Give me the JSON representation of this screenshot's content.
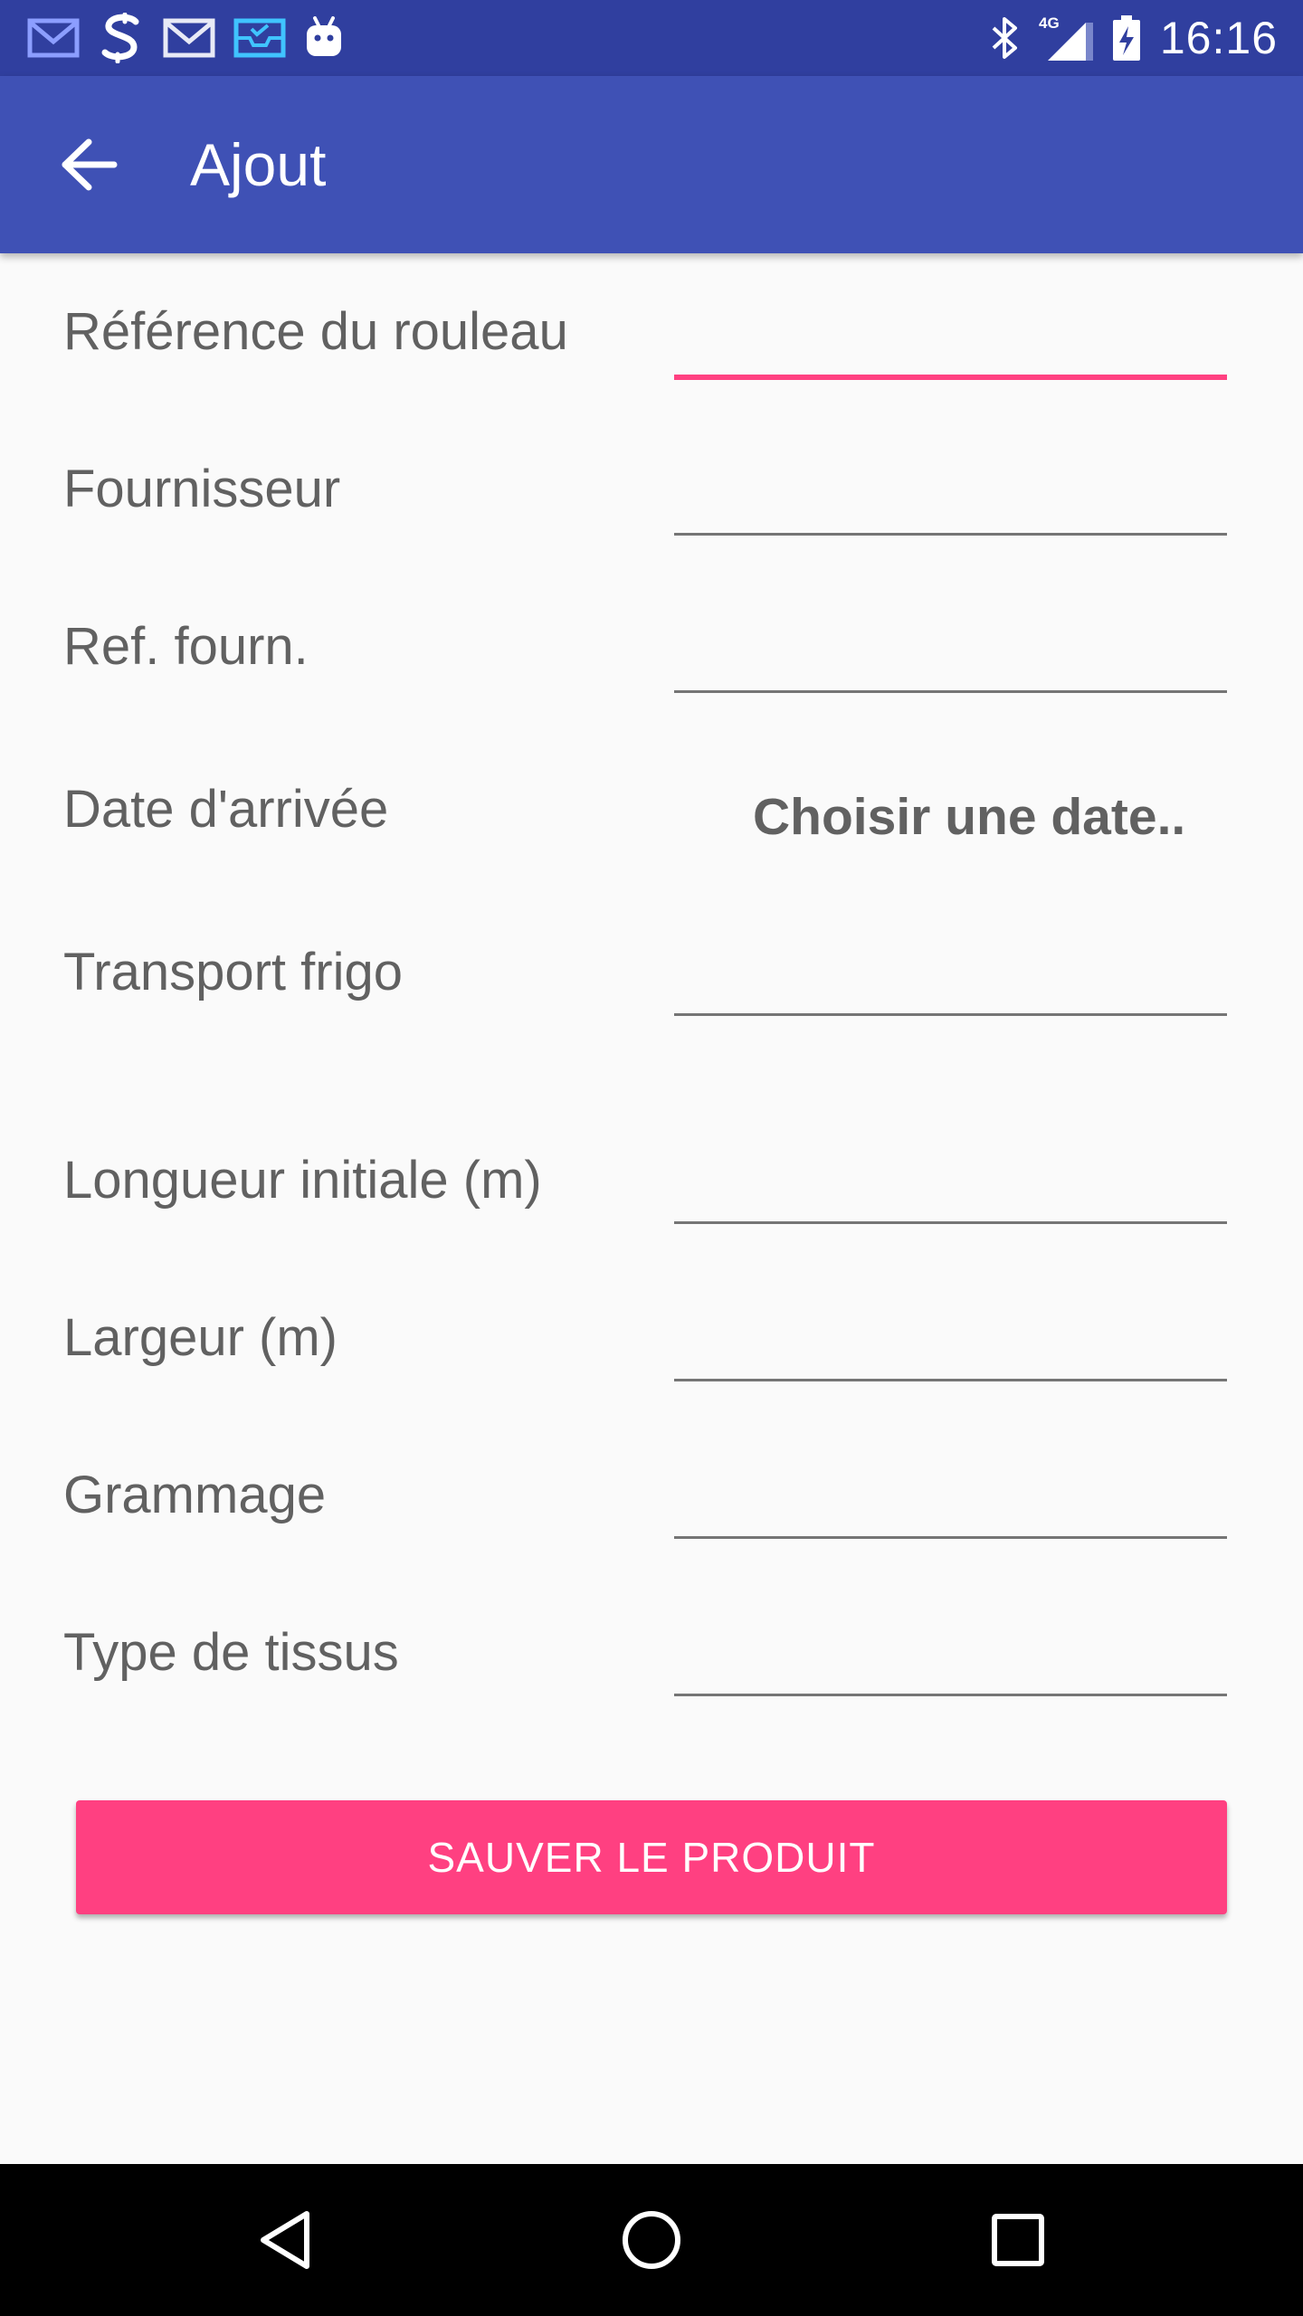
{
  "status_bar": {
    "time": "16:16",
    "network_label": "4G",
    "notification_icons": [
      "gmail-icon",
      "s-app-icon",
      "gmail-icon",
      "inbox-icon",
      "android-debug-icon"
    ]
  },
  "app_bar": {
    "title": "Ajout"
  },
  "form": {
    "fields": [
      {
        "label": "Référence du rouleau",
        "value": ""
      },
      {
        "label": "Fournisseur",
        "value": ""
      },
      {
        "label": "Ref. fourn.",
        "value": ""
      },
      {
        "label": "Date d'arrivée",
        "button_label": "Choisir une date.."
      },
      {
        "label": "Transport frigo",
        "value": ""
      },
      {
        "label": "Longueur initiale (m)",
        "value": ""
      },
      {
        "label": "Largeur (m)",
        "value": ""
      },
      {
        "label": "Grammage",
        "value": ""
      },
      {
        "label": "Type de tissus",
        "value": ""
      }
    ],
    "save_label": "SAUVER LE PRODUIT"
  },
  "colors": {
    "status_bar": "#303F9F",
    "app_bar": "#3F51B5",
    "accent": "#FF4081",
    "background": "#FAFAFA",
    "label_text": "#616161"
  }
}
